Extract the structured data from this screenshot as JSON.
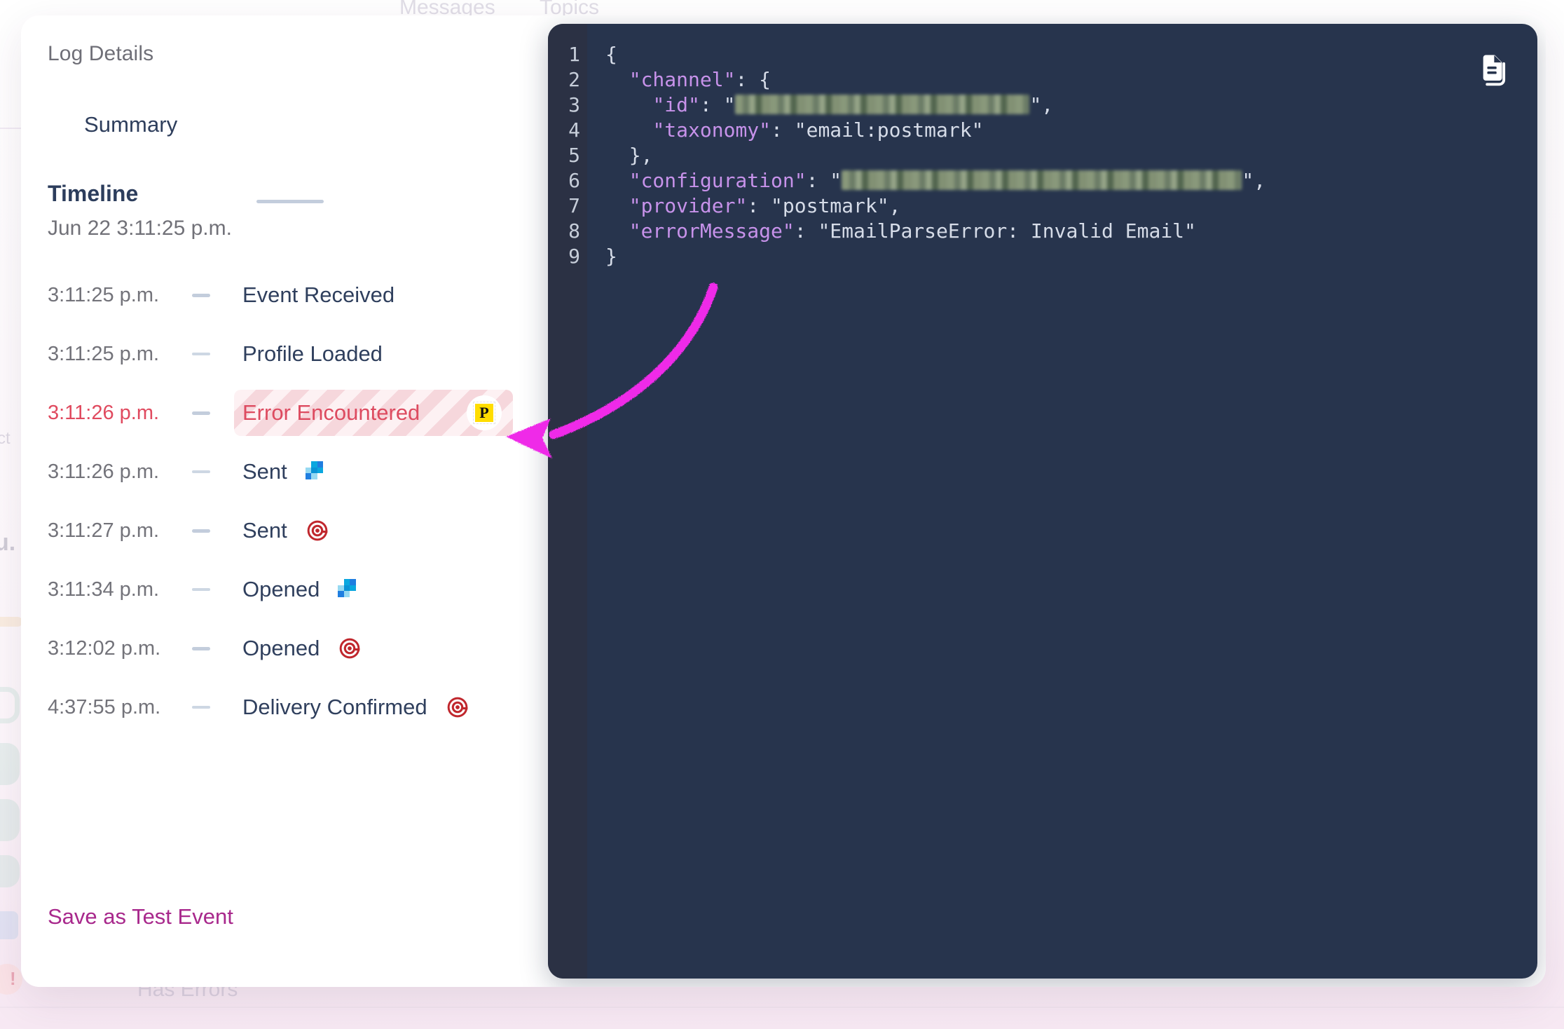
{
  "background": {
    "tabs": [
      {
        "label": "Messages"
      },
      {
        "label": "Topics"
      }
    ],
    "left_fragments": [
      {
        "label": "ct"
      },
      {
        "label": "u."
      }
    ],
    "has_errors_label": "Has Errors"
  },
  "modal": {
    "title": "Log Details",
    "tabs": [
      {
        "label": "Summary",
        "selected": true
      }
    ],
    "timeline": {
      "heading": "Timeline",
      "date": "Jun 22 3:11:25 p.m.",
      "rows": [
        {
          "time": "3:11:25 p.m.",
          "label": "Event Received",
          "icon": "none",
          "error": false
        },
        {
          "time": "3:11:25 p.m.",
          "label": "Profile Loaded",
          "icon": "none",
          "error": false
        },
        {
          "time": "3:11:26 p.m.",
          "label": "Error Encountered",
          "icon": "postmark-logo-icon",
          "error": true
        },
        {
          "time": "3:11:26 p.m.",
          "label": "Sent",
          "icon": "mosaic-blue-icon",
          "error": false
        },
        {
          "time": "3:11:27 p.m.",
          "label": "Sent",
          "icon": "mailgun-target-icon",
          "error": false
        },
        {
          "time": "3:11:34 p.m.",
          "label": "Opened",
          "icon": "mosaic-blue-icon",
          "error": false
        },
        {
          "time": "3:12:02 p.m.",
          "label": "Opened",
          "icon": "mailgun-target-icon",
          "error": false
        },
        {
          "time": "4:37:55 p.m.",
          "label": "Delivery Confirmed",
          "icon": "mailgun-target-icon",
          "error": false
        }
      ]
    },
    "save_test_event_label": "Save as Test Event"
  },
  "code_panel": {
    "copy_icon": "copy-document-icon",
    "line_numbers": [
      "1",
      "2",
      "3",
      "4",
      "5",
      "6",
      "7",
      "8",
      "9"
    ],
    "lines": [
      {
        "n": "1",
        "text": "{"
      },
      {
        "n": "2",
        "text": "  \"channel\": {"
      },
      {
        "n": "3",
        "text": "    \"id\": \"█████████████████████████\",",
        "redacted": true
      },
      {
        "n": "4",
        "text": "    \"taxonomy\": \"email:postmark\""
      },
      {
        "n": "5",
        "text": "  },"
      },
      {
        "n": "6",
        "text": "  \"configuration\": \"██████████████████████████████████\",",
        "redacted": true
      },
      {
        "n": "7",
        "text": "  \"provider\": \"postmark\","
      },
      {
        "n": "8",
        "text": "  \"errorMessage\": \"EmailParseError: Invalid Email\""
      },
      {
        "n": "9",
        "text": "}"
      }
    ],
    "values": {
      "taxonomy": "email:postmark",
      "provider": "postmark",
      "errorMessage": "EmailParseError: Invalid Email"
    },
    "keys": [
      "channel",
      "id",
      "taxonomy",
      "configuration",
      "provider",
      "errorMessage"
    ]
  },
  "annotation": {
    "type": "curved-arrow",
    "color": "#ef2ae8",
    "points_to": "Error Encountered"
  },
  "colors": {
    "accent_link": "#a8288c",
    "error_text": "#dd4b60",
    "heading": "#2c3d5c",
    "muted_text": "#73737a",
    "code_bg": "#27344d",
    "code_gutter": "#2b3144",
    "code_key": "#c792ea",
    "code_string": "#b9e67c",
    "postmark_yellow": "#ffdd00",
    "mailgun_red": "#c02b2b",
    "annotation_magenta": "#ef2ae8"
  }
}
